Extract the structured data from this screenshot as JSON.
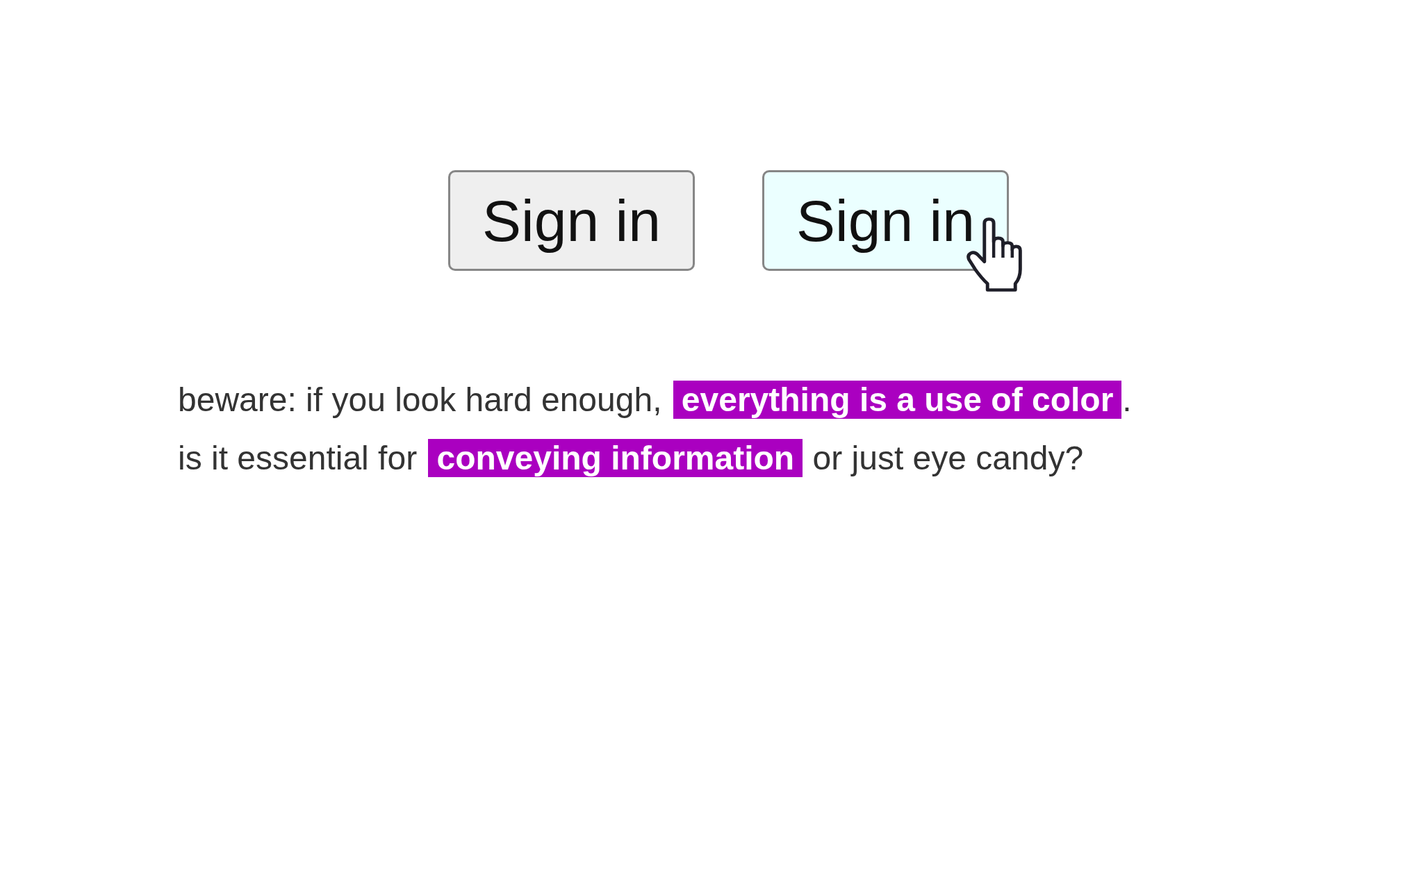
{
  "buttons": [
    {
      "label": "Sign in",
      "hovered": false
    },
    {
      "label": "Sign in",
      "hovered": true
    }
  ],
  "paragraphs": [
    "beware: if you look hard enough, **everything is a use of color**.",
    "is it essential for **conveying information** or just eye candy?"
  ]
}
